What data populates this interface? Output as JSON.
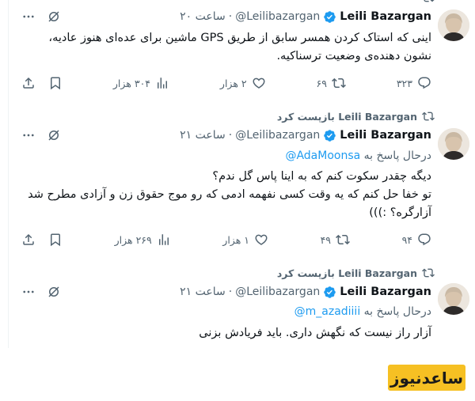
{
  "tweets": [
    {
      "retweet_label": "",
      "name": "Leili Bazargan",
      "handle": "@Leilibazargan",
      "time": "ساعت ۲۰",
      "reply_prefix": "",
      "reply_mention": "",
      "text": "اینی که استاک کردن همسر سابق از طریق GPS ماشین برای عده‌ای هنوز عادیه، نشون دهنده‌ی وضعیت ترسناکیه.",
      "replies": "۳۲۳",
      "retweets": "۶۹",
      "likes": "۲ هزار",
      "views": "۳۰۴ هزار"
    },
    {
      "retweet_label": "Leili Bazargan بازپست کرد",
      "name": "Leili Bazargan",
      "handle": "@Leilibazargan",
      "time": "ساعت ۲۱",
      "reply_prefix": "درحال پاسخ به",
      "reply_mention": "@AdaMoonsa",
      "text": "دیگه چقدر سکوت کنم که به اینا پاس گل ندم؟\nتو خفا حل کنم که یه وقت کسی نفهمه ادمی که رو موج حقوق زن و آزادی مطرح شد آزارگره؟ :)))",
      "replies": "۹۴",
      "retweets": "۴۹",
      "likes": "۱ هزار",
      "views": "۲۶۹ هزار"
    },
    {
      "retweet_label": "Leili Bazargan بازپست کرد",
      "name": "Leili Bazargan",
      "handle": "@Leilibazargan",
      "time": "ساعت ۲۱",
      "reply_prefix": "درحال پاسخ به",
      "reply_mention": "@m_azadiiii",
      "text": "آزار راز نیست که نگهش داری. باید فریادش بزنی"
    }
  ],
  "logo_text": "ساعدنیوز",
  "colors": {
    "accent": "#1d9bf0",
    "muted": "#536471",
    "text": "#0f1419",
    "logo_bg": "#f6c023"
  },
  "icons": [
    "more-icon",
    "grok-icon",
    "verified-icon",
    "retweet-icon",
    "reply-icon",
    "like-icon",
    "views-icon",
    "bookmark-icon",
    "share-icon"
  ]
}
